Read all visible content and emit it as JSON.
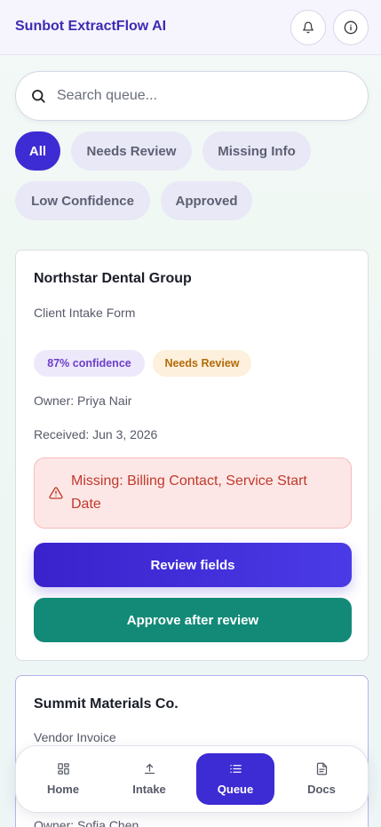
{
  "app": {
    "title": "Sunbot ExtractFlow AI"
  },
  "header": {
    "notifications_icon": "bell-icon",
    "info_icon": "info-icon"
  },
  "search": {
    "placeholder": "Search queue...",
    "value": ""
  },
  "filters": [
    {
      "label": "All",
      "active": true
    },
    {
      "label": "Needs Review",
      "active": false
    },
    {
      "label": "Missing Info",
      "active": false
    },
    {
      "label": "Low Confidence",
      "active": false
    },
    {
      "label": "Approved",
      "active": false
    }
  ],
  "queue": [
    {
      "company": "Northstar Dental Group",
      "doc_type": "Client Intake Form",
      "confidence": "87% confidence",
      "status": "Needs Review",
      "owner": "Owner: Priya Nair",
      "received": "Received: Jun 3, 2026",
      "missing": "Missing: Billing Contact, Service Start Date",
      "primary_action": "Review fields",
      "secondary_action": "Approve after review"
    },
    {
      "company": "Summit Materials Co.",
      "doc_type": "Vendor Invoice",
      "owner": "Owner: Sofia Chen"
    }
  ],
  "nav": [
    {
      "label": "Home",
      "icon": "grid-icon",
      "active": false
    },
    {
      "label": "Intake",
      "icon": "upload-icon",
      "active": false
    },
    {
      "label": "Queue",
      "icon": "list-icon",
      "active": true
    },
    {
      "label": "Docs",
      "icon": "document-icon",
      "active": false
    }
  ],
  "colors": {
    "brand": "#3d2bb3",
    "accent": "#3d2bd3",
    "approve": "#128a77",
    "alert_text": "#c0392b",
    "confidence_text": "#6b3fc9",
    "status_text": "#b26b0a"
  }
}
